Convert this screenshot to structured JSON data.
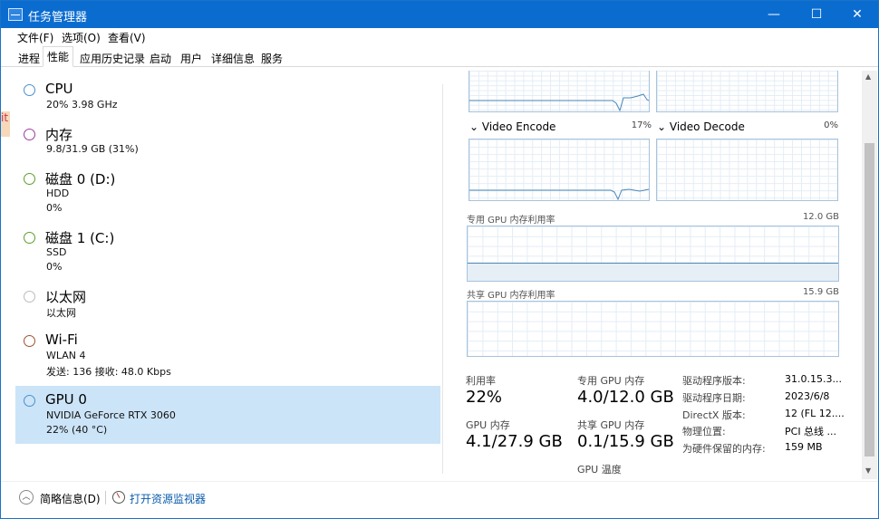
{
  "window": {
    "title": "任务管理器",
    "minimize": "—",
    "maximize": "☐",
    "close": "✕"
  },
  "menu": [
    "文件(F)",
    "选项(O)",
    "查看(V)"
  ],
  "tabs": [
    "进程",
    "性能",
    "应用历史记录",
    "启动",
    "用户",
    "详细信息",
    "服务"
  ],
  "active_tab": "性能",
  "devices": [
    {
      "name": "CPU",
      "lines": [
        "20% 3.98 GHz"
      ],
      "ring_color": "#4a90d0"
    },
    {
      "name": "内存",
      "lines": [
        "9.8/31.9 GB (31%)"
      ],
      "ring_color": "#9a3ea0"
    },
    {
      "name": "磁盘 0 (D:)",
      "lines": [
        "HDD",
        "0%"
      ],
      "ring_color": "#5aa02c"
    },
    {
      "name": "磁盘 1 (C:)",
      "lines": [
        "SSD",
        "0%"
      ],
      "ring_color": "#5aa02c"
    },
    {
      "name": "以太网",
      "lines": [
        "以太网"
      ],
      "ring_color": "#bbbbbb"
    },
    {
      "name": "Wi-Fi",
      "lines": [
        "WLAN 4",
        "发送: 136 接收: 48.0 Kbps"
      ],
      "ring_color": "#a0522d"
    },
    {
      "name": "GPU 0",
      "lines": [
        "NVIDIA GeForce RTX 3060",
        "22% (40 °C)"
      ],
      "ring_color": "#4a90d0"
    }
  ],
  "engines": {
    "encode": {
      "label": "Video Encode",
      "pct": "17%"
    },
    "decode": {
      "label": "Video Decode",
      "pct": "0%"
    }
  },
  "memgraphs": {
    "dedicated": {
      "label": "专用 GPU 内存利用率",
      "max": "12.0 GB"
    },
    "shared": {
      "label": "共享 GPU 内存利用率",
      "max": "15.9 GB"
    }
  },
  "stats": {
    "util": {
      "k": "利用率",
      "v": "22%"
    },
    "gpu_mem": {
      "k": "GPU 内存",
      "v": "4.1/27.9 GB"
    },
    "ded_mem": {
      "k": "专用 GPU 内存",
      "v": "4.0/12.0 GB"
    },
    "sh_mem": {
      "k": "共享 GPU 内存",
      "v": "0.1/15.9 GB"
    },
    "temp": {
      "k": "GPU 温度"
    }
  },
  "props": [
    {
      "k": "驱动程序版本:",
      "v": "31.0.15.3..."
    },
    {
      "k": "驱动程序日期:",
      "v": "2023/6/8"
    },
    {
      "k": "DirectX 版本:",
      "v": "12 (FL 12...."
    },
    {
      "k": "物理位置:",
      "v": "PCI 总线 ..."
    },
    {
      "k": "为硬件保留的内存:",
      "v": "159 MB"
    }
  ],
  "bottom": {
    "fewer": "简略信息(D)",
    "resmon": "打开资源监视器",
    "chevron": "︿"
  },
  "scroll": {
    "up": "▲",
    "down": "▼"
  },
  "edge": "it",
  "colors": {
    "titlebar": "#0b6cd0",
    "selected": "#cce4f7",
    "graph_line": "#4a87b8",
    "graph_border": "#a7c3dd"
  }
}
